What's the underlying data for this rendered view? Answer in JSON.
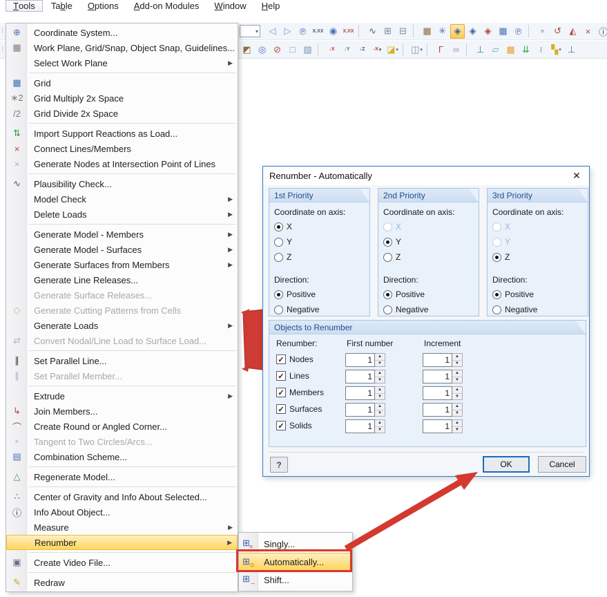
{
  "menubar": {
    "items": [
      {
        "label": "Tools",
        "accel": 0,
        "open": true
      },
      {
        "label": "Table",
        "accel": 2
      },
      {
        "label": "Options",
        "accel": 0
      },
      {
        "label": "Add-on Modules",
        "accel": 0
      },
      {
        "label": "Window",
        "accel": 0
      },
      {
        "label": "Help",
        "accel": 0
      }
    ]
  },
  "toolbar_row1": [
    {
      "type": "combo",
      "name": "toolbar-combo"
    },
    {
      "type": "icon",
      "name": "view-previous-icon",
      "glyph": "◁",
      "color": "#6b9bd2"
    },
    {
      "type": "icon",
      "name": "view-next-icon",
      "glyph": "▷",
      "color": "#6b9bd2"
    },
    {
      "type": "icon",
      "name": "numbering-icon",
      "glyph": "℗",
      "color": "#4a72b8"
    },
    {
      "type": "icon",
      "name": "dimension-lines-icon",
      "glyph": "X.XX",
      "small": true,
      "color": "#555a66"
    },
    {
      "type": "icon",
      "name": "display-points-icon",
      "glyph": "◉",
      "color": "#4a72b8"
    },
    {
      "type": "icon",
      "name": "dimension-values-icon",
      "glyph": "X.XX",
      "small": true,
      "color": "#b04a3a"
    },
    {
      "type": "sep"
    },
    {
      "type": "icon",
      "name": "plausibility-toolbar-icon",
      "glyph": "∿",
      "color": "#555a66"
    },
    {
      "type": "icon",
      "name": "table-panel-icon",
      "glyph": "⊞",
      "color": "#7a86a0"
    },
    {
      "type": "icon",
      "name": "table-panel2-icon",
      "glyph": "⊟",
      "color": "#7a86a0"
    },
    {
      "type": "sep"
    },
    {
      "type": "icon",
      "name": "snap-grid-icon",
      "glyph": "▦",
      "color": "#8a6d3b"
    },
    {
      "type": "icon",
      "name": "snap-points-icon",
      "glyph": "✳",
      "color": "#4a72b8"
    },
    {
      "type": "icon",
      "name": "workplane-xy-icon",
      "glyph": "◈",
      "color": "#3b62a8",
      "highlighted": true
    },
    {
      "type": "icon",
      "name": "workplane-yz-icon",
      "glyph": "◈",
      "color": "#3b62a8"
    },
    {
      "type": "icon",
      "name": "workplane-xz-icon",
      "glyph": "◈",
      "color": "#b04a3a"
    },
    {
      "type": "icon",
      "name": "grid-toolbar-icon",
      "glyph": "▦",
      "color": "#4a72b8"
    },
    {
      "type": "icon",
      "name": "select-workplane-icon",
      "glyph": "℗",
      "color": "#4a72b8"
    },
    {
      "type": "sep"
    },
    {
      "type": "icon",
      "name": "tangent-toolbar-icon",
      "glyph": "∘",
      "color": "#8a8f99"
    },
    {
      "type": "icon",
      "name": "rotate-toolbar-icon",
      "glyph": "↺",
      "color": "#b04a3a"
    },
    {
      "type": "icon",
      "name": "mirror-toolbar-icon",
      "glyph": "◭",
      "color": "#b04a3a"
    },
    {
      "type": "icon",
      "name": "connect-toolbar-icon",
      "glyph": "×",
      "color": "#b04a3a"
    },
    {
      "type": "icon",
      "name": "info-toolbar-icon",
      "glyph": "ⓘ",
      "color": "#26324f"
    },
    {
      "type": "icon",
      "name": "settings-toolbar-icon",
      "glyph": "◑",
      "color": "#d99a2b"
    }
  ],
  "toolbar_row2": [
    {
      "type": "icon",
      "name": "render-mode-icon",
      "glyph": "◩",
      "color": "#8a6d3b"
    },
    {
      "type": "icon",
      "name": "zoom-window-icon",
      "glyph": "◎",
      "color": "#4a72b8"
    },
    {
      "type": "icon",
      "name": "zoom-cancel-icon",
      "glyph": "⊘",
      "color": "#b04a3a"
    },
    {
      "type": "icon",
      "name": "isometric-view-icon",
      "glyph": "□",
      "color": "#7f96b2"
    },
    {
      "type": "icon",
      "name": "perspective-view-icon",
      "glyph": "▧",
      "color": "#7f96b2"
    },
    {
      "type": "sep"
    },
    {
      "type": "icon",
      "name": "view-in-x-icon",
      "glyph": "↓X",
      "small": true,
      "color": "#c03a2e"
    },
    {
      "type": "icon",
      "name": "view-in-y-icon",
      "glyph": "↓Y",
      "small": true,
      "color": "#2e8f3c"
    },
    {
      "type": "icon",
      "name": "view-in-z-icon",
      "glyph": "↓Z",
      "small": true,
      "color": "#2e4fc0"
    },
    {
      "type": "icon",
      "name": "view-in-minus-x-icon",
      "glyph": "-X",
      "small": true,
      "color": "#c03a2e",
      "dropdown": true
    },
    {
      "type": "icon",
      "name": "workplane-tool-icon",
      "glyph": "◪",
      "color": "#d9b01c",
      "dropdown": true
    },
    {
      "type": "sep"
    },
    {
      "type": "icon",
      "name": "display-properties-icon",
      "glyph": "◫",
      "color": "#7f96b2",
      "dropdown": true
    },
    {
      "type": "sep"
    },
    {
      "type": "icon",
      "name": "new-member-icon",
      "glyph": "Γ",
      "color": "#b04a3a"
    },
    {
      "type": "icon",
      "name": "connect-members-icon",
      "glyph": "∞",
      "color": "#9aa0ab"
    },
    {
      "type": "sep"
    },
    {
      "type": "icon",
      "name": "new-support-icon",
      "glyph": "⊥",
      "color": "#4a72b8"
    },
    {
      "type": "icon",
      "name": "new-surface-icon",
      "glyph": "▱",
      "color": "#52b8a0"
    },
    {
      "type": "icon",
      "name": "new-solid-icon",
      "glyph": "▩",
      "color": "#e6a23c"
    },
    {
      "type": "icon",
      "name": "new-load-icon",
      "glyph": "⇊",
      "color": "#3fa34d"
    },
    {
      "type": "icon",
      "name": "new-release-icon",
      "glyph": "≀",
      "color": "#7f96b2"
    },
    {
      "type": "icon",
      "name": "blocks-library-icon",
      "glyph": "▚",
      "color": "#d9b01c",
      "dropdown": true
    },
    {
      "type": "icon",
      "name": "support2-icon",
      "glyph": "⊥",
      "color": "#4a72b8"
    }
  ],
  "tools_menu": {
    "items": [
      {
        "label": "Coordinate System...",
        "icon": "coordinate-system-icon",
        "glyph": "⊕",
        "color": "#4a6fb5"
      },
      {
        "label": "Work Plane, Grid/Snap, Object Snap, Guidelines...",
        "icon": "work-plane-icon",
        "glyph": "▦",
        "color": "#7d7d7d"
      },
      {
        "label": "Select Work Plane",
        "submenu": true,
        "sep": true
      },
      {
        "label": "Grid",
        "icon": "grid-icon",
        "glyph": "▦",
        "color": "#3d6db5"
      },
      {
        "label": "Grid Multiply 2x Space",
        "icon": "grid-multiply-icon",
        "glyph": "∗2",
        "color": "#7d7d7d"
      },
      {
        "label": "Grid Divide 2x Space",
        "icon": "grid-divide-icon",
        "glyph": "/2",
        "color": "#7d7d7d",
        "sep": true
      },
      {
        "label": "Import Support Reactions as Load...",
        "icon": "import-support-reactions-icon",
        "glyph": "⇅",
        "color": "#2e9e3c"
      },
      {
        "label": "Connect Lines/Members",
        "icon": "connect-lines-icon",
        "glyph": "×",
        "color": "#c43c3c"
      },
      {
        "label": "Generate Nodes at Intersection Point of Lines",
        "icon": "generate-nodes-icon",
        "glyph": "×",
        "color": "#9db9d6",
        "sep": true
      },
      {
        "label": "Plausibility Check...",
        "icon": "plausibility-check-icon",
        "glyph": "∿",
        "color": "#555555"
      },
      {
        "label": "Model Check",
        "submenu": true
      },
      {
        "label": "Delete Loads",
        "submenu": true,
        "sep": true
      },
      {
        "label": "Generate Model - Members",
        "submenu": true
      },
      {
        "label": "Generate Model - Surfaces",
        "submenu": true
      },
      {
        "label": "Generate Surfaces from Members",
        "submenu": true
      },
      {
        "label": "Generate Line Releases..."
      },
      {
        "label": "Generate Surface Releases...",
        "disabled": true
      },
      {
        "label": "Generate Cutting Patterns from Cells",
        "disabled": true,
        "icon": "cutting-patterns-icon",
        "glyph": "◇",
        "color": "#c9b98a"
      },
      {
        "label": "Generate Loads",
        "submenu": true
      },
      {
        "label": "Convert Nodal/Line Load to Surface Load...",
        "disabled": true,
        "icon": "convert-load-icon",
        "glyph": "⇄",
        "color": "#a9b4c4",
        "sep": true
      },
      {
        "label": "Set Parallel Line...",
        "icon": "set-parallel-line-icon",
        "glyph": "∥",
        "color": "#333333"
      },
      {
        "label": "Set Parallel Member...",
        "disabled": true,
        "icon": "set-parallel-member-icon",
        "glyph": "∥",
        "color": "#aab4c4",
        "sep": true
      },
      {
        "label": "Extrude",
        "submenu": true
      },
      {
        "label": "Join Members...",
        "icon": "join-members-icon",
        "glyph": "↳",
        "color": "#b04a3a"
      },
      {
        "label": "Create Round or Angled Corner...",
        "icon": "round-corner-icon",
        "glyph": "⌒",
        "color": "#b04a3a"
      },
      {
        "label": "Tangent to Two Circles/Arcs...",
        "disabled": true,
        "icon": "tangent-icon",
        "glyph": "∘",
        "color": "#aab4c4"
      },
      {
        "label": "Combination Scheme...",
        "icon": "combination-scheme-icon",
        "glyph": "▤",
        "color": "#4a6fb5",
        "sep": true
      },
      {
        "label": "Regenerate Model...",
        "icon": "regenerate-model-icon",
        "glyph": "△",
        "color": "#3fa34d",
        "sep": true
      },
      {
        "label": "Center of Gravity and Info About Selected...",
        "icon": "center-of-gravity-icon",
        "glyph": "∴",
        "color": "#555566"
      },
      {
        "label": "Info About Object...",
        "icon": "info-about-object-icon",
        "glyph": "ⓘ",
        "color": "#26324f"
      },
      {
        "label": "Measure",
        "submenu": true
      },
      {
        "label": "Renumber",
        "submenu": true,
        "highlight": true,
        "sep": true
      },
      {
        "label": "Create Video File...",
        "icon": "create-video-icon",
        "glyph": "▣",
        "color": "#667188",
        "sep": true
      },
      {
        "label": "Redraw",
        "icon": "redraw-icon",
        "glyph": "✎",
        "color": "#d9a520"
      }
    ]
  },
  "renumber_submenu": {
    "items": [
      {
        "label": "Singly...",
        "icon": "renumber-singly-icon",
        "base": "⊞",
        "sub": "×",
        "sub_color": "#c02828"
      },
      {
        "label": "Automatically...",
        "icon": "renumber-automatically-icon",
        "base": "⊞",
        "sub": "⚙",
        "sub_color": "#caa12c",
        "highlight": true
      },
      {
        "label": "Shift...",
        "icon": "renumber-shift-icon",
        "base": "⊞",
        "sub": "→",
        "sub_color": "#c02828"
      }
    ]
  },
  "dialog": {
    "title": "Renumber - Automatically",
    "close_glyph": "✕",
    "priority_groups": [
      {
        "title": "1st Priority",
        "coord_label": "Coordinate on axis:",
        "axes": [
          {
            "label": "X",
            "state": "selected"
          },
          {
            "label": "Y",
            "state": "normal"
          },
          {
            "label": "Z",
            "state": "normal"
          }
        ],
        "dir_label": "Direction:",
        "dirs": [
          {
            "label": "Positive",
            "state": "selected"
          },
          {
            "label": "Negative",
            "state": "normal"
          }
        ]
      },
      {
        "title": "2nd Priority",
        "coord_label": "Coordinate on axis:",
        "axes": [
          {
            "label": "X",
            "state": "disabled"
          },
          {
            "label": "Y",
            "state": "selected"
          },
          {
            "label": "Z",
            "state": "normal"
          }
        ],
        "dir_label": "Direction:",
        "dirs": [
          {
            "label": "Positive",
            "state": "selected"
          },
          {
            "label": "Negative",
            "state": "normal"
          }
        ]
      },
      {
        "title": "3rd Priority",
        "coord_label": "Coordinate on axis:",
        "axes": [
          {
            "label": "X",
            "state": "disabled"
          },
          {
            "label": "Y",
            "state": "disabled"
          },
          {
            "label": "Z",
            "state": "selected"
          }
        ],
        "dir_label": "Direction:",
        "dirs": [
          {
            "label": "Positive",
            "state": "selected"
          },
          {
            "label": "Negative",
            "state": "normal"
          }
        ]
      }
    ],
    "objects": {
      "title": "Objects to Renumber",
      "renumber_label": "Renumber:",
      "first_number_label": "First number",
      "increment_label": "Increment",
      "rows": [
        {
          "label": "Nodes",
          "checked": true,
          "first": "1",
          "increment": "1"
        },
        {
          "label": "Lines",
          "checked": true,
          "first": "1",
          "increment": "1"
        },
        {
          "label": "Members",
          "checked": true,
          "first": "1",
          "increment": "1"
        },
        {
          "label": "Surfaces",
          "checked": true,
          "first": "1",
          "increment": "1"
        },
        {
          "label": "Solids",
          "checked": true,
          "first": "1",
          "increment": "1"
        }
      ]
    },
    "help_label": "?",
    "ok_label": "OK",
    "cancel_label": "Cancel"
  },
  "annotations": {
    "color": "#d23b33",
    "border": "#b02a24"
  }
}
